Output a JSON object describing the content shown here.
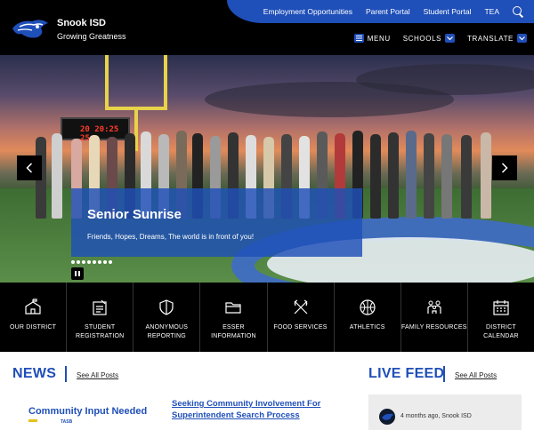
{
  "header": {
    "site_name": "Snook ISD",
    "tagline": "Growing Greatness",
    "util_links": [
      "Employment Opportunities",
      "Parent Portal",
      "Student Portal",
      "TEA"
    ],
    "nav": {
      "menu": "MENU",
      "schools": "SCHOOLS",
      "translate": "TRANSLATE"
    }
  },
  "hero": {
    "scoreboard": "20 20:25 25",
    "title": "Senior Sunrise",
    "subtitle": "Friends, Hopes, Dreams, The world is in front of you!"
  },
  "quick_links": [
    {
      "label": "OUR DISTRICT",
      "icon": "school-icon"
    },
    {
      "label": "STUDENT REGISTRATION",
      "icon": "clipboard-icon"
    },
    {
      "label": "ANONYMOUS REPORTING",
      "icon": "shield-icon"
    },
    {
      "label": "ESSER INFORMATION",
      "icon": "folder-icon"
    },
    {
      "label": "FOOD SERVICES",
      "icon": "utensils-icon"
    },
    {
      "label": "ATHLETICS",
      "icon": "basketball-icon"
    },
    {
      "label": "FAMILY RESOURCES",
      "icon": "family-icon"
    },
    {
      "label": "DISTRICT CALENDAR",
      "icon": "calendar-icon"
    }
  ],
  "news": {
    "heading": "NEWS",
    "see_all": "See All Posts",
    "item_image_text": "Community Input Needed",
    "item_image_tag": "TASB",
    "item_title": "Seeking Community Involvement For Superintendent Search Process"
  },
  "live_feed": {
    "heading": "LIVE FEED",
    "see_all": "See All Posts",
    "post_meta": "4 months ago, Snook ISD"
  },
  "colors": {
    "brand_blue": "#1f4fb8",
    "header_bg": "#000000"
  }
}
